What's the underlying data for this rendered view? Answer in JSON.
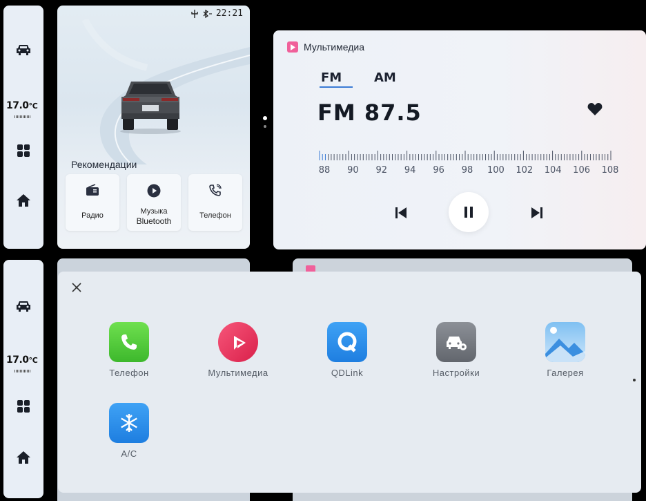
{
  "rail": {
    "temperature": "17.0",
    "temperature_unit": "℃",
    "icons": [
      "car-icon",
      "apps-grid-icon",
      "home-icon"
    ]
  },
  "status_bar": {
    "time": "22:21",
    "icons": [
      "usb-icon",
      "bluetooth-icon"
    ]
  },
  "recommendations": {
    "title": "Рекомендации",
    "tiles": [
      {
        "label": "Радио",
        "icon": "radio-icon"
      },
      {
        "label_line1": "Музыка",
        "label_line2": "Bluetooth",
        "icon": "play-circle-icon"
      },
      {
        "label": "Телефон",
        "icon": "phone-call-icon"
      }
    ]
  },
  "media": {
    "title": "Мультимедиа",
    "tabs": [
      "FM",
      "AM"
    ],
    "active_tab": "FM",
    "frequency": "FM 87.5",
    "favorite": true,
    "scale_labels": [
      "88",
      "90",
      "92",
      "94",
      "96",
      "98",
      "100",
      "102",
      "104",
      "106",
      "108"
    ],
    "controls": [
      "previous-icon",
      "pause-icon",
      "next-icon"
    ],
    "accent_color": "#f0609a"
  },
  "drawer": {
    "apps": [
      {
        "label": "Телефон",
        "icon": "phone-app-icon",
        "color": "#4cc93a"
      },
      {
        "label": "Мультимедиа",
        "icon": "multimedia-app-icon",
        "color": "#ee3d59"
      },
      {
        "label": "QDLink",
        "icon": "qdlink-app-icon",
        "color": "#2f8ff0"
      },
      {
        "label": "Настройки",
        "icon": "settings-app-icon",
        "color": "#7a7e85"
      },
      {
        "label": "Галерея",
        "icon": "gallery-app-icon",
        "color": "#8cc4f0"
      },
      {
        "label": "A/C",
        "icon": "ac-app-icon",
        "color": "#2f8ff0"
      }
    ]
  }
}
